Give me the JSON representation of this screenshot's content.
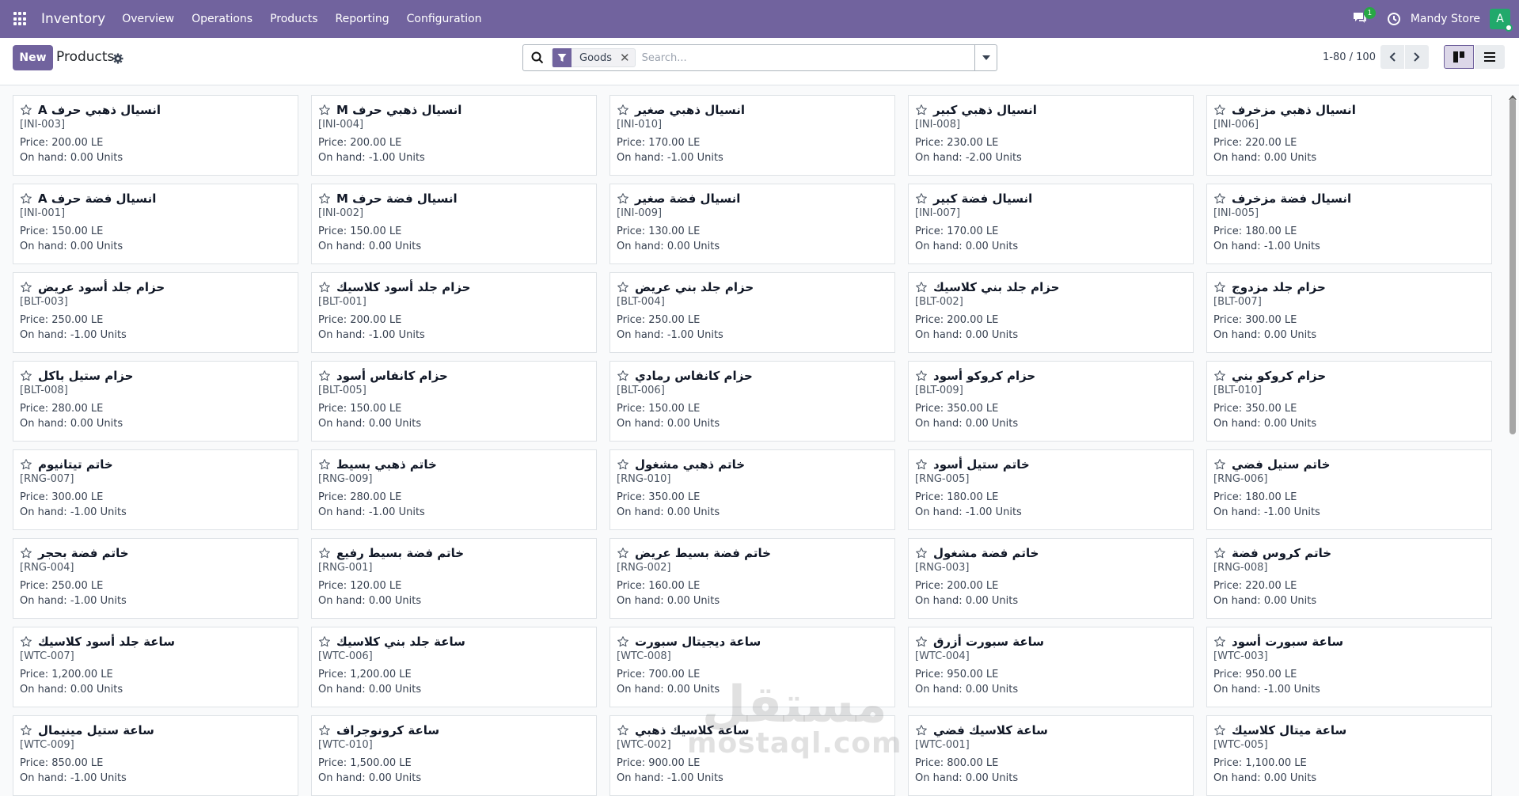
{
  "app": {
    "brand": "Inventory",
    "menu": [
      "Overview",
      "Operations",
      "Products",
      "Reporting",
      "Configuration"
    ],
    "chat_count": "1",
    "company": "Mandy Store",
    "avatar_letter": "A"
  },
  "control": {
    "new_label": "New",
    "title": "Products",
    "facet": "Goods",
    "search_placeholder": "Search...",
    "pager": "1-80 / 100"
  },
  "products": [
    {
      "name": "انسيال ذهبي حرف A",
      "code": "[INI-003]",
      "price": "Price: 200.00 LE",
      "onhand": "On hand: 0.00 Units"
    },
    {
      "name": "انسيال ذهبي حرف M",
      "code": "[INI-004]",
      "price": "Price: 200.00 LE",
      "onhand": "On hand: -1.00 Units"
    },
    {
      "name": "انسيال ذهبي صغير",
      "code": "[INI-010]",
      "price": "Price: 170.00 LE",
      "onhand": "On hand: -1.00 Units"
    },
    {
      "name": "انسيال ذهبي كبير",
      "code": "[INI-008]",
      "price": "Price: 230.00 LE",
      "onhand": "On hand: -2.00 Units"
    },
    {
      "name": "انسيال ذهبي مزخرف",
      "code": "[INI-006]",
      "price": "Price: 220.00 LE",
      "onhand": "On hand: 0.00 Units"
    },
    {
      "name": "انسيال فضة حرف A",
      "code": "[INI-001]",
      "price": "Price: 150.00 LE",
      "onhand": "On hand: 0.00 Units"
    },
    {
      "name": "انسيال فضة حرف M",
      "code": "[INI-002]",
      "price": "Price: 150.00 LE",
      "onhand": "On hand: 0.00 Units"
    },
    {
      "name": "انسيال فضة صغير",
      "code": "[INI-009]",
      "price": "Price: 130.00 LE",
      "onhand": "On hand: 0.00 Units"
    },
    {
      "name": "انسيال فضة كبير",
      "code": "[INI-007]",
      "price": "Price: 170.00 LE",
      "onhand": "On hand: 0.00 Units"
    },
    {
      "name": "انسيال فضة مزخرف",
      "code": "[INI-005]",
      "price": "Price: 180.00 LE",
      "onhand": "On hand: -1.00 Units"
    },
    {
      "name": "حزام جلد أسود عريض",
      "code": "[BLT-003]",
      "price": "Price: 250.00 LE",
      "onhand": "On hand: -1.00 Units"
    },
    {
      "name": "حزام جلد أسود كلاسيك",
      "code": "[BLT-001]",
      "price": "Price: 200.00 LE",
      "onhand": "On hand: -1.00 Units"
    },
    {
      "name": "حزام جلد بني عريض",
      "code": "[BLT-004]",
      "price": "Price: 250.00 LE",
      "onhand": "On hand: -1.00 Units"
    },
    {
      "name": "حزام جلد بني كلاسيك",
      "code": "[BLT-002]",
      "price": "Price: 200.00 LE",
      "onhand": "On hand: 0.00 Units"
    },
    {
      "name": "حزام جلد مزدوج",
      "code": "[BLT-007]",
      "price": "Price: 300.00 LE",
      "onhand": "On hand: 0.00 Units"
    },
    {
      "name": "حزام ستيل باكل",
      "code": "[BLT-008]",
      "price": "Price: 280.00 LE",
      "onhand": "On hand: 0.00 Units"
    },
    {
      "name": "حزام كانفاس أسود",
      "code": "[BLT-005]",
      "price": "Price: 150.00 LE",
      "onhand": "On hand: 0.00 Units"
    },
    {
      "name": "حزام كانفاس رمادي",
      "code": "[BLT-006]",
      "price": "Price: 150.00 LE",
      "onhand": "On hand: 0.00 Units"
    },
    {
      "name": "حزام كروكو أسود",
      "code": "[BLT-009]",
      "price": "Price: 350.00 LE",
      "onhand": "On hand: 0.00 Units"
    },
    {
      "name": "حزام كروكو بني",
      "code": "[BLT-010]",
      "price": "Price: 350.00 LE",
      "onhand": "On hand: 0.00 Units"
    },
    {
      "name": "خاتم تيتانيوم",
      "code": "[RNG-007]",
      "price": "Price: 300.00 LE",
      "onhand": "On hand: -1.00 Units"
    },
    {
      "name": "خاتم ذهبي بسيط",
      "code": "[RNG-009]",
      "price": "Price: 280.00 LE",
      "onhand": "On hand: -1.00 Units"
    },
    {
      "name": "خاتم ذهبي مشغول",
      "code": "[RNG-010]",
      "price": "Price: 350.00 LE",
      "onhand": "On hand: 0.00 Units"
    },
    {
      "name": "خاتم ستيل أسود",
      "code": "[RNG-005]",
      "price": "Price: 180.00 LE",
      "onhand": "On hand: -1.00 Units"
    },
    {
      "name": "خاتم ستيل فضي",
      "code": "[RNG-006]",
      "price": "Price: 180.00 LE",
      "onhand": "On hand: -1.00 Units"
    },
    {
      "name": "خاتم فضة بحجر",
      "code": "[RNG-004]",
      "price": "Price: 250.00 LE",
      "onhand": "On hand: -1.00 Units"
    },
    {
      "name": "خاتم فضة بسيط رفيع",
      "code": "[RNG-001]",
      "price": "Price: 120.00 LE",
      "onhand": "On hand: 0.00 Units"
    },
    {
      "name": "خاتم فضة بسيط عريض",
      "code": "[RNG-002]",
      "price": "Price: 160.00 LE",
      "onhand": "On hand: 0.00 Units"
    },
    {
      "name": "خاتم فضة مشغول",
      "code": "[RNG-003]",
      "price": "Price: 200.00 LE",
      "onhand": "On hand: 0.00 Units"
    },
    {
      "name": "خاتم كروس فضة",
      "code": "[RNG-008]",
      "price": "Price: 220.00 LE",
      "onhand": "On hand: 0.00 Units"
    },
    {
      "name": "ساعة جلد أسود كلاسيك",
      "code": "[WTC-007]",
      "price": "Price: 1,200.00 LE",
      "onhand": "On hand: 0.00 Units"
    },
    {
      "name": "ساعة جلد بني كلاسيك",
      "code": "[WTC-006]",
      "price": "Price: 1,200.00 LE",
      "onhand": "On hand: 0.00 Units"
    },
    {
      "name": "ساعة ديجيتال سبورت",
      "code": "[WTC-008]",
      "price": "Price: 700.00 LE",
      "onhand": "On hand: 0.00 Units"
    },
    {
      "name": "ساعة سبورت أزرق",
      "code": "[WTC-004]",
      "price": "Price: 950.00 LE",
      "onhand": "On hand: 0.00 Units"
    },
    {
      "name": "ساعة سبورت أسود",
      "code": "[WTC-003]",
      "price": "Price: 950.00 LE",
      "onhand": "On hand: -1.00 Units"
    },
    {
      "name": "ساعة ستيل مينيمال",
      "code": "[WTC-009]",
      "price": "Price: 850.00 LE",
      "onhand": "On hand: -1.00 Units"
    },
    {
      "name": "ساعة كرونوجراف",
      "code": "[WTC-010]",
      "price": "Price: 1,500.00 LE",
      "onhand": "On hand: 0.00 Units"
    },
    {
      "name": "ساعة كلاسيك ذهبي",
      "code": "[WTC-002]",
      "price": "Price: 900.00 LE",
      "onhand": "On hand: -1.00 Units"
    },
    {
      "name": "ساعة كلاسيك فضي",
      "code": "[WTC-001]",
      "price": "Price: 800.00 LE",
      "onhand": "On hand: 0.00 Units"
    },
    {
      "name": "ساعة ميتال كلاسيك",
      "code": "[WTC-005]",
      "price": "Price: 1,100.00 LE",
      "onhand": "On hand: 0.00 Units"
    }
  ],
  "watermark": {
    "arabic": "مستقل",
    "latin": "mostaql.com"
  },
  "colors": {
    "brand": "#71639e",
    "avatar": "#21a96b",
    "badge": "#28a745"
  },
  "icons": [
    "apps-grid-icon",
    "chat-icon",
    "clock-icon",
    "gear-icon",
    "search-icon",
    "filter-icon",
    "close-icon",
    "caret-down-icon",
    "chevron-left-icon",
    "chevron-right-icon",
    "kanban-view-icon",
    "list-view-icon",
    "star-icon"
  ]
}
